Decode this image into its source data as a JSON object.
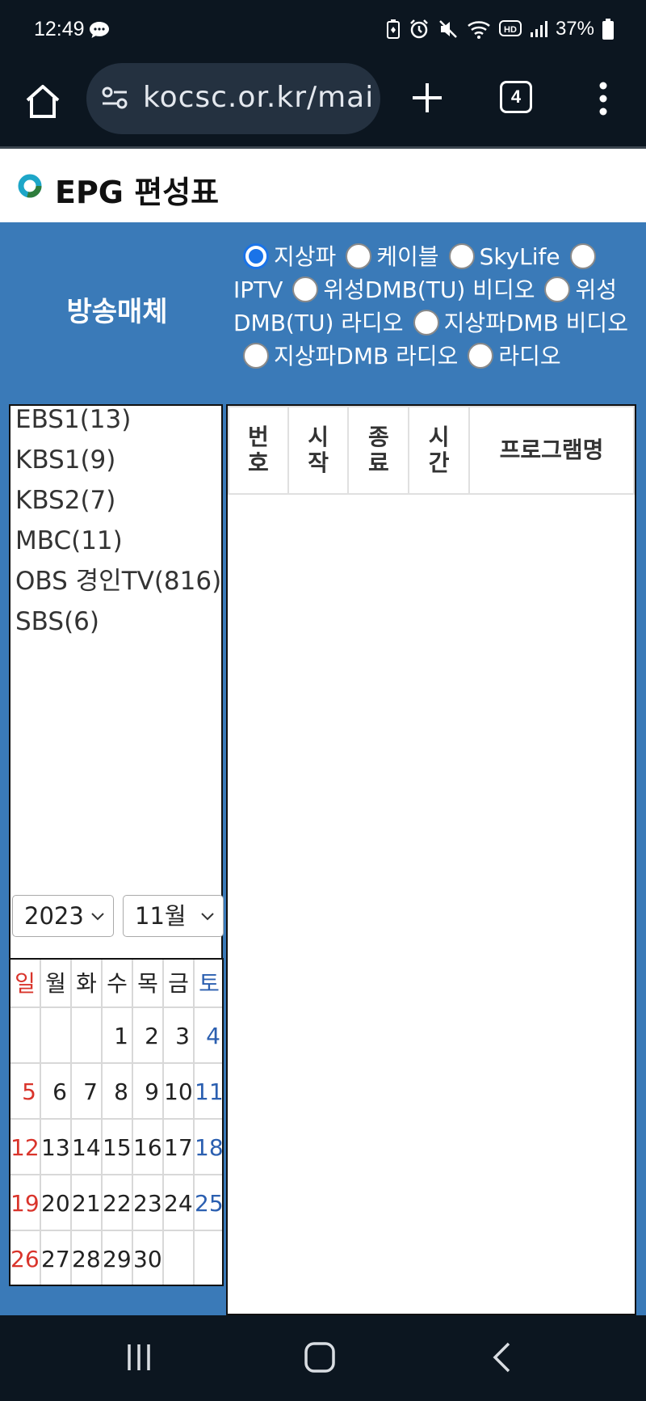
{
  "status_bar": {
    "time": "12:49",
    "battery": "37%",
    "icons": [
      "chat-bubble-icon",
      "battery-saver-icon",
      "alarm-icon",
      "mute-icon",
      "wifi-icon",
      "hd-icon",
      "signal-icon",
      "battery-icon"
    ]
  },
  "browser": {
    "url": "kocsc.or.kr/mai",
    "tab_count": "4",
    "icons": [
      "home-icon",
      "tune-icon",
      "plus-icon",
      "more-vert-icon"
    ]
  },
  "page": {
    "title": "EPG 편성표"
  },
  "media": {
    "label": "방송매체",
    "options": [
      {
        "label": "지상파",
        "checked": true
      },
      {
        "label": "케이블",
        "checked": false
      },
      {
        "label": "SkyLife",
        "checked": false
      },
      {
        "label": "IPTV",
        "checked": false
      },
      {
        "label": "위성DMB(TU) 비디오",
        "checked": false
      },
      {
        "label": "위성DMB(TU) 라디오",
        "checked": false
      },
      {
        "label": "지상파DMB 비디오",
        "checked": false
      },
      {
        "label": "지상파DMB 라디오",
        "checked": false
      },
      {
        "label": "라디오",
        "checked": false
      }
    ]
  },
  "channels": [
    "EBS1(13)",
    "KBS1(9)",
    "KBS2(7)",
    "MBC(11)",
    "OBS 경인TV(816)",
    "SBS(6)"
  ],
  "table": {
    "headers": [
      "번\n호",
      "시\n작",
      "종\n료",
      "시\n간",
      "프로그램명"
    ]
  },
  "date": {
    "year": "2023",
    "month": "11월"
  },
  "calendar": {
    "weekdays": [
      "일",
      "월",
      "화",
      "수",
      "목",
      "금",
      "토"
    ],
    "weeks": [
      [
        "",
        "",
        "",
        "1",
        "2",
        "3",
        "4"
      ],
      [
        "5",
        "6",
        "7",
        "8",
        "9",
        "10",
        "11"
      ],
      [
        "12",
        "13",
        "14",
        "15",
        "16",
        "17",
        "18"
      ],
      [
        "19",
        "20",
        "21",
        "22",
        "23",
        "24",
        "25"
      ],
      [
        "26",
        "27",
        "28",
        "29",
        "30",
        "",
        ""
      ]
    ],
    "colors": {
      "sunday": "#d9342b",
      "saturday": "#2b5fb0"
    }
  },
  "colors": {
    "panel_blue": "#3a7ab8",
    "chrome_dark": "#0c1620",
    "radio_accent": "#1a73e8"
  }
}
